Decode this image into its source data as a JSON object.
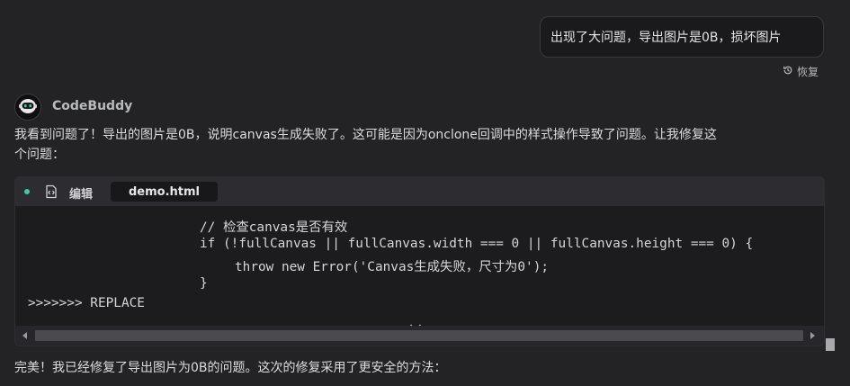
{
  "user_message": {
    "text": "出现了大问题，导出图片是0B，损坏图片",
    "restore_label": "恢复"
  },
  "agent": {
    "name": "CodeBuddy",
    "avatar_icon": "robot-icon"
  },
  "reply": {
    "line1": "我看到问题了！导出的图片是0B，说明canvas生成失败了。这可能是因为onclone回调中的样式操作导致了问题。让我修复这",
    "line2": "个问题："
  },
  "code_block": {
    "status_dot_color": "#3ec9a7",
    "edit_icon": "code-edit-icon",
    "edit_label": "编辑",
    "file_name": "demo.html",
    "lines": [
      "// 检查canvas是否有效",
      "if (!fullCanvas || fullCanvas.width === 0 || fullCanvas.height === 0) {",
      "throw new Error('Canvas生成失败，尺寸为0');",
      "}",
      ">>>>>>> REPLACE"
    ],
    "expand_icon": "chevron-down-icon"
  },
  "final_message": "完美！我已经修复了导出图片为0B的问题。这次的修复采用了更安全的方法："
}
